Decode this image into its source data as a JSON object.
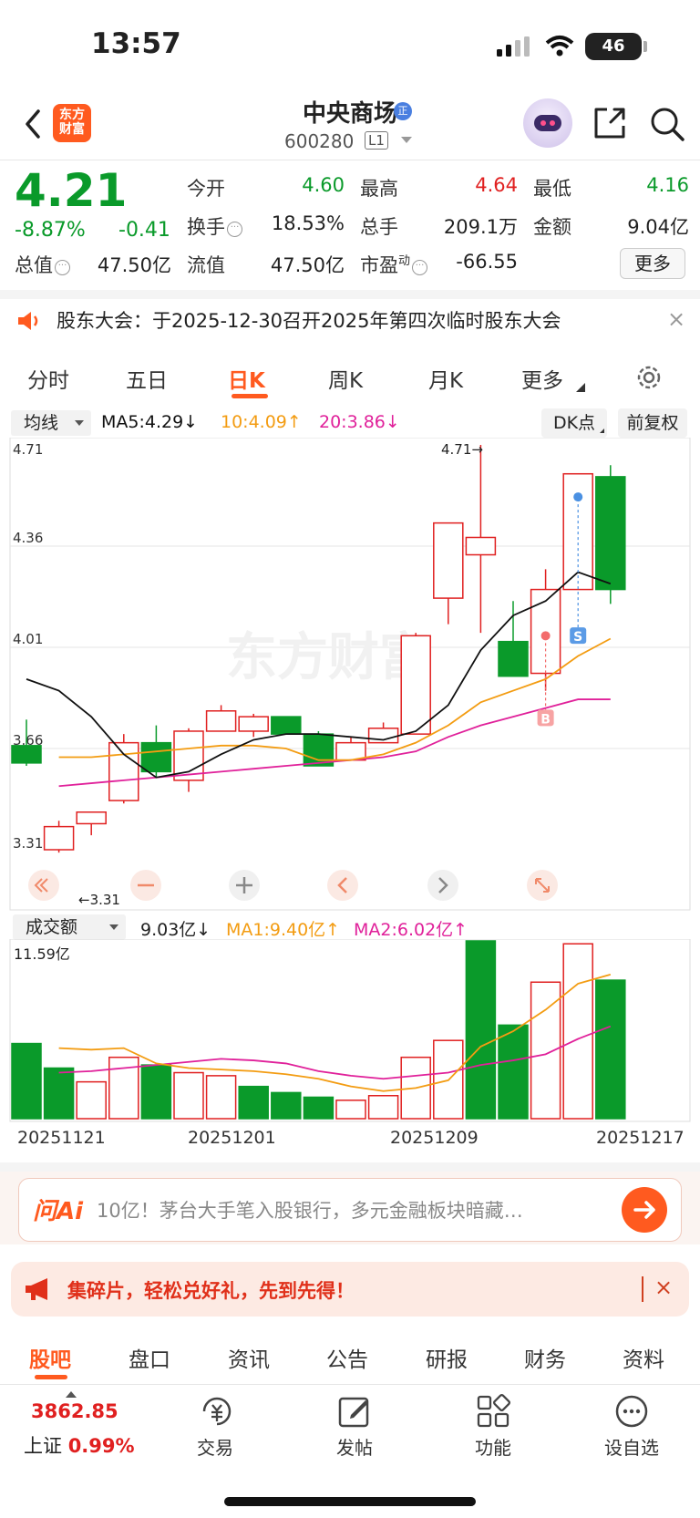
{
  "status": {
    "time": "13:57",
    "battery": "46"
  },
  "header": {
    "logo_line1": "东方",
    "logo_line2": "财富",
    "stock_name": "中央商场",
    "name_badge": "正",
    "stock_code": "600280",
    "code_badge": "L1"
  },
  "quote": {
    "price": "4.21",
    "change_pct": "-8.87%",
    "change_abs": "-0.41",
    "open_label": "今开",
    "open": "4.60",
    "high_label": "最高",
    "high": "4.64",
    "low_label": "最低",
    "low": "4.16",
    "turnover_label": "换手",
    "turnover": "18.53%",
    "volume_label": "总手",
    "volume": "209.1万",
    "amount_label": "金额",
    "amount": "9.04亿",
    "mktcap_label": "总值",
    "mktcap": "47.50亿",
    "float_label": "流值",
    "float_cap": "47.50亿",
    "pe_label": "市盈",
    "pe_sup": "动",
    "pe": "-66.55",
    "more_label": "更多"
  },
  "notice": {
    "text": "股东大会：于2025-12-30召开2025年第四次临时股东大会",
    "close": "×"
  },
  "period_tabs": {
    "t1": "分时",
    "t2": "五日",
    "t3": "日K",
    "t4": "周K",
    "t5": "月K",
    "t6": "更多"
  },
  "ma_row": {
    "select": "均线",
    "ma5": "MA5:4.29↓",
    "ma10": "10:4.09↑",
    "ma20": "20:3.86↓",
    "dk": "DK点",
    "fq": "前复权"
  },
  "vol_row": {
    "select": "成交额",
    "value": "9.03亿↓",
    "ma1": "MA1:9.40亿↑",
    "ma2": "MA2:6.02亿↑"
  },
  "colors": {
    "up": "#e02020",
    "down": "#0a9a2a",
    "ma5": "#111111",
    "ma10": "#f39c12",
    "ma20": "#e0219a",
    "accent": "#ff5a1f"
  },
  "chart_data": [
    {
      "type": "candlestick",
      "y_ticks": [
        "4.71",
        "4.36",
        "4.01",
        "3.66",
        "3.31"
      ],
      "ylim": [
        3.31,
        4.71
      ],
      "max_label": "4.71→",
      "min_label": "←3.31",
      "watermark": "东方财富",
      "candles": [
        {
          "o": 3.67,
          "h": 3.76,
          "l": 3.6,
          "c": 3.61
        },
        {
          "o": 3.31,
          "h": 3.41,
          "l": 3.3,
          "c": 3.39
        },
        {
          "o": 3.4,
          "h": 3.44,
          "l": 3.36,
          "c": 3.44
        },
        {
          "o": 3.48,
          "h": 3.71,
          "l": 3.47,
          "c": 3.68
        },
        {
          "o": 3.68,
          "h": 3.74,
          "l": 3.56,
          "c": 3.58
        },
        {
          "o": 3.55,
          "h": 3.73,
          "l": 3.51,
          "c": 3.72
        },
        {
          "o": 3.72,
          "h": 3.81,
          "l": 3.72,
          "c": 3.79
        },
        {
          "o": 3.72,
          "h": 3.78,
          "l": 3.7,
          "c": 3.77
        },
        {
          "o": 3.77,
          "h": 3.77,
          "l": 3.71,
          "c": 3.71
        },
        {
          "o": 3.71,
          "h": 3.72,
          "l": 3.6,
          "c": 3.6
        },
        {
          "o": 3.62,
          "h": 3.7,
          "l": 3.62,
          "c": 3.68
        },
        {
          "o": 3.68,
          "h": 3.75,
          "l": 3.68,
          "c": 3.73
        },
        {
          "o": 3.71,
          "h": 4.06,
          "l": 3.71,
          "c": 4.05
        },
        {
          "o": 4.18,
          "h": 4.44,
          "l": 4.09,
          "c": 4.44
        },
        {
          "o": 4.33,
          "h": 4.71,
          "l": 4.06,
          "c": 4.39
        },
        {
          "o": 4.03,
          "h": 4.17,
          "l": 3.97,
          "c": 3.91
        },
        {
          "o": 3.92,
          "h": 4.28,
          "l": 3.86,
          "c": 4.21
        },
        {
          "o": 4.21,
          "h": 4.61,
          "l": 4.21,
          "c": 4.61
        },
        {
          "o": 4.6,
          "h": 4.64,
          "l": 4.16,
          "c": 4.21
        }
      ],
      "ma5": [
        3.9,
        3.86,
        3.77,
        3.64,
        3.56,
        3.58,
        3.64,
        3.69,
        3.71,
        3.71,
        3.7,
        3.69,
        3.72,
        3.81,
        4.0,
        4.12,
        4.17,
        4.27,
        4.23
      ],
      "ma10": [
        null,
        3.63,
        3.63,
        3.64,
        3.65,
        3.66,
        3.67,
        3.67,
        3.66,
        3.62,
        3.62,
        3.64,
        3.68,
        3.74,
        3.82,
        3.86,
        3.9,
        3.98,
        4.04
      ],
      "ma20": [
        null,
        3.53,
        3.54,
        3.55,
        3.56,
        3.57,
        3.58,
        3.59,
        3.6,
        3.61,
        3.62,
        3.63,
        3.65,
        3.7,
        3.74,
        3.77,
        3.8,
        3.83,
        3.83
      ],
      "signals": [
        {
          "label": "B",
          "index": 16,
          "price": 4.05
        },
        {
          "label": "S",
          "index": 17,
          "price": 4.53
        }
      ]
    },
    {
      "type": "bar",
      "title": "成交额",
      "y_max_label": "11.59亿",
      "ylim": [
        0,
        11.59
      ],
      "values": [
        4.9,
        3.3,
        2.4,
        4.0,
        3.5,
        3.0,
        2.8,
        2.1,
        1.7,
        1.4,
        1.2,
        1.5,
        4.0,
        5.1,
        11.59,
        6.1,
        8.9,
        11.4,
        9.03
      ],
      "up": [
        false,
        false,
        true,
        true,
        false,
        true,
        true,
        false,
        false,
        false,
        true,
        true,
        true,
        true,
        false,
        false,
        true,
        true,
        false
      ],
      "ma1": [
        null,
        4.6,
        4.5,
        4.6,
        3.6,
        3.3,
        3.2,
        3.1,
        2.9,
        2.6,
        2.1,
        1.8,
        2.0,
        2.5,
        4.7,
        5.7,
        7.1,
        8.8,
        9.4
      ],
      "ma2": [
        null,
        3.0,
        3.1,
        3.3,
        3.5,
        3.7,
        3.9,
        3.8,
        3.6,
        3.1,
        2.8,
        2.6,
        2.8,
        3.0,
        3.5,
        3.8,
        4.2,
        5.2,
        6.02
      ],
      "x_labels": [
        "20251121",
        "20251201",
        "20251209",
        "20251217"
      ]
    }
  ],
  "ai": {
    "logo": "问Ai",
    "text": "10亿！茅台大手笔入股银行，多元金融板块暗藏…"
  },
  "promo": {
    "text": "集碎片，轻松兑好礼，先到先得！",
    "close": "×"
  },
  "sub_tabs": {
    "s1": "股吧",
    "s2": "盘口",
    "s3": "资讯",
    "s4": "公告",
    "s5": "研报",
    "s6": "财务",
    "s7": "资料"
  },
  "bottom_nav": {
    "index_value": "3862.85",
    "index_name": "上证",
    "index_pct": "0.99%",
    "trade": "交易",
    "post": "发帖",
    "func": "功能",
    "watch": "设自选"
  }
}
